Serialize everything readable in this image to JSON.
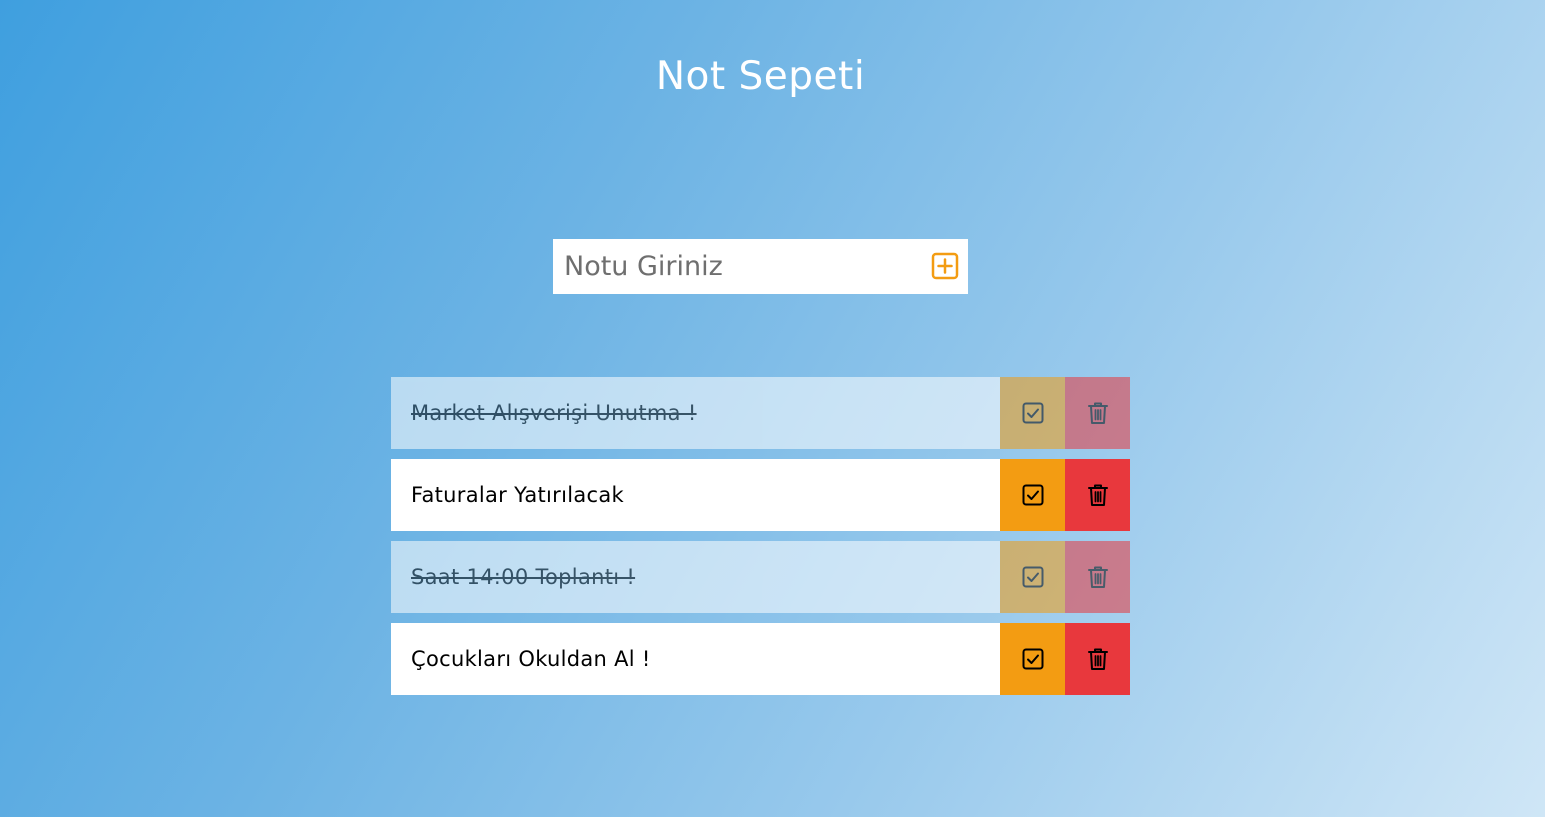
{
  "app": {
    "title": "Not Sepeti"
  },
  "form": {
    "placeholder": "Notu Giriniz",
    "value": "",
    "add_icon": "plus-square-icon"
  },
  "colors": {
    "accent": "#f39c12",
    "danger": "#e8383d",
    "background_start": "#3f9fdf",
    "background_end": "#cfe6f6"
  },
  "todos": [
    {
      "text": "Market Alışverişi Unutma !",
      "completed": true
    },
    {
      "text": "Faturalar Yatırılacak",
      "completed": false
    },
    {
      "text": "Saat 14:00 Toplantı !",
      "completed": true
    },
    {
      "text": "Çocukları Okuldan Al !",
      "completed": false
    }
  ],
  "icons": {
    "complete": "check-square-icon",
    "delete": "trash-icon"
  }
}
